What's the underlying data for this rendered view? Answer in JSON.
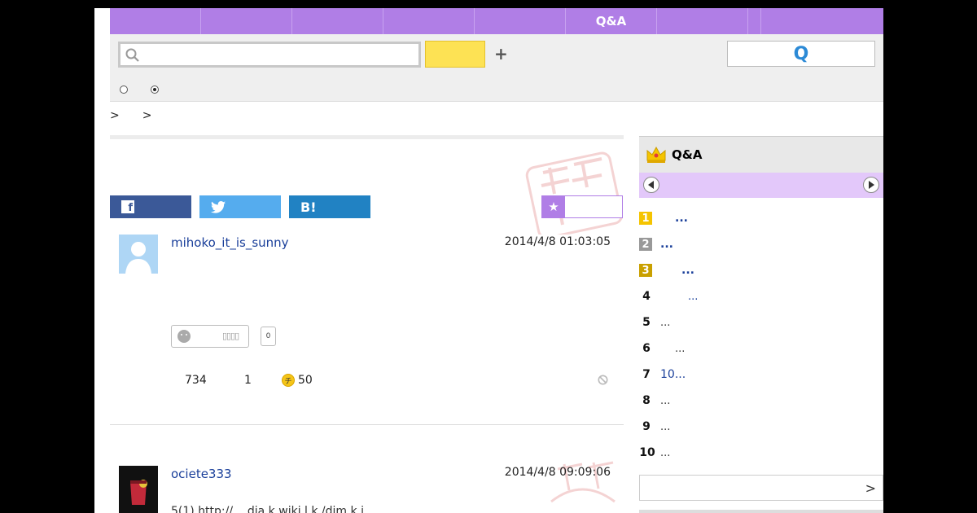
{
  "topnav": {
    "items": [
      "",
      "",
      "",
      "",
      "",
      "Q&A",
      "",
      "",
      ""
    ]
  },
  "search": {
    "placeholder": "",
    "value": "",
    "submit_label": "",
    "add_label": "+",
    "qa_label": "Q"
  },
  "breadcrumb": {
    "separators": [
      ">",
      ">"
    ]
  },
  "share": {
    "facebook_label": "f",
    "twitter_label": "",
    "hatena_label": "B!",
    "favorite_label": "★"
  },
  "posts": [
    {
      "username": "mihoko_it_is_sunny",
      "datetime": "2014/4/8  01:03:05",
      "reaction_label": "▯▯▯▯",
      "reaction_count": "0",
      "stats": {
        "views": "734",
        "answers": "1",
        "coins": "50",
        "coin_icon": "チ"
      }
    },
    {
      "username": "ociete333",
      "datetime": "2014/4/8  09:09:06",
      "body_fragment": "5(1)                                    http://...    dia k  wiki  l  k  /dim k  i"
    }
  ],
  "sidebar": {
    "title": "Q&A",
    "ranking": [
      {
        "rank": "1",
        "title": "..."
      },
      {
        "rank": "2",
        "title": "..."
      },
      {
        "rank": "3",
        "title": "..."
      },
      {
        "rank": "4",
        "title": "..."
      },
      {
        "rank": "5",
        "title": "..."
      },
      {
        "rank": "6",
        "title": "..."
      },
      {
        "rank": "7",
        "title": "10..."
      },
      {
        "rank": "8",
        "title": "..."
      },
      {
        "rank": "9",
        "title": "..."
      },
      {
        "rank": "10",
        "title": "..."
      }
    ],
    "more_label": ">"
  },
  "colors": {
    "accent": "#b07ee6",
    "accent_light": "#e3c8fa",
    "search_button": "#fde254",
    "link": "#1a3f9a",
    "gold": "#f5c400",
    "silver": "#999999",
    "bronze": "#c9a000"
  }
}
